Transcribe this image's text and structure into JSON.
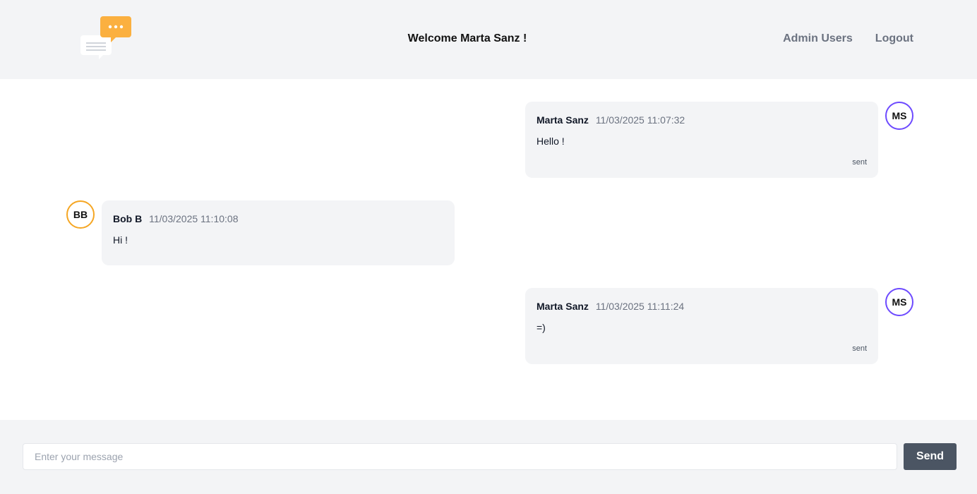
{
  "header": {
    "welcome": "Welcome Marta Sanz !",
    "nav": [
      {
        "label": "Admin Users"
      },
      {
        "label": "Logout"
      }
    ],
    "logo_icon": "chat-bubbles-icon",
    "colors": {
      "background": "#f3f4f6",
      "logo_accent": "#fbb040"
    }
  },
  "messages": [
    {
      "author": "Marta Sanz",
      "time": "11/03/2025 11:07:32",
      "text": "Hello !",
      "status": "sent",
      "avatar": "MS",
      "side": "right"
    },
    {
      "author": "Bob B",
      "time": "11/03/2025 11:10:08",
      "text": "Hi !",
      "status": "",
      "avatar": "BB",
      "side": "left"
    },
    {
      "author": "Marta Sanz",
      "time": "11/03/2025 11:11:24",
      "text": "=)",
      "status": "sent",
      "avatar": "MS",
      "side": "right"
    }
  ],
  "composer": {
    "placeholder": "Enter your message",
    "value": "",
    "send_label": "Send"
  },
  "colors": {
    "self_avatar_border": "#6d4aff",
    "other_avatar_border": "#f5a623",
    "send_button": "#4b5563"
  }
}
